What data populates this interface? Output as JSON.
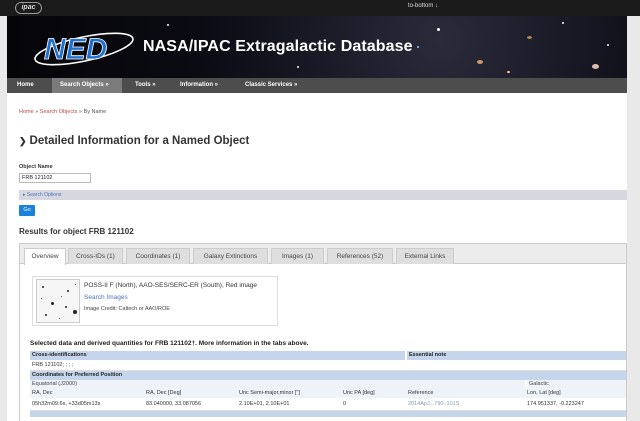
{
  "topbar": {
    "logo_text": "ipac",
    "to_bottom": "to-bottom ↓"
  },
  "banner": {
    "logo_text": "NED",
    "title": "NASA/IPAC Extragalactic Database"
  },
  "nav": [
    {
      "label": "Home",
      "active": false
    },
    {
      "label": "Search Objects »",
      "active": true
    },
    {
      "label": "Tools »",
      "active": false
    },
    {
      "label": "Information »",
      "active": false
    },
    {
      "label": "Classic Services »",
      "active": false
    }
  ],
  "breadcrumb": {
    "home": "Home",
    "sep1": " » ",
    "search_objects": "Search Objects",
    "sep2": " » ",
    "current": "By Name"
  },
  "page_title": {
    "arrow": "❯",
    "text": "Detailed Information for a Named Object"
  },
  "form": {
    "object_name_label": "Object Name",
    "object_name_value": "FRB 121102",
    "search_options": "▸ Search Options",
    "go_label": "Go"
  },
  "results_title": "Results for object FRB 121102",
  "tabs": [
    {
      "label": "Overview",
      "active": true
    },
    {
      "label": "Cross-IDs (1)",
      "active": false
    },
    {
      "label": "Coordinates (1)",
      "active": false
    },
    {
      "label": "Galaxy Extinctions",
      "active": false
    },
    {
      "label": "Images (1)",
      "active": false
    },
    {
      "label": "References (52)",
      "active": false
    },
    {
      "label": "External Links",
      "active": false
    }
  ],
  "image_card": {
    "caption": "POSS-II F (North), AAO-SES/SERC-ER (South), Red image",
    "search_images": "Search Images",
    "credit": "Image Credit: Caltech or AAO/ROE"
  },
  "selected_heading": "Selected data and derived quantities for FRB 121102†.  More information in the tabs above.",
  "cross_ids": {
    "header": "Cross-identifications",
    "essential_note": "Essential note",
    "value": "FRB 121102; ; ; ;"
  },
  "coords": {
    "header": "Coordinates for Preferred Position",
    "equatorial": "Equatorial (J2000)",
    "galactic": "Galactic",
    "columns": [
      "RA, Dec",
      "RA, Dec [Deg]",
      "Unc Semi-major,minor [\"]",
      "Unc PA [deg]",
      "Reference",
      "Lon, Lat [deg]"
    ],
    "row": [
      "05h32m09.6s, +33d05m13s",
      "83.040000, 33.087056",
      "2.10E+01, 2.10E+01",
      "0",
      "2014ApJ...790..101S",
      "174.951337, -0.223247"
    ]
  },
  "colors": {
    "accent": "#1a82d8",
    "link": "#4a76c0",
    "breadcrumb_link": "#c44444",
    "table_header": "#c5d6ec"
  }
}
